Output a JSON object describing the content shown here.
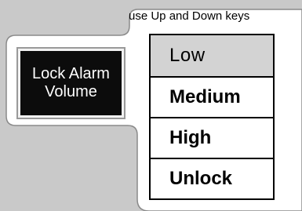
{
  "hint": "use Up and Down keys",
  "lock_button": {
    "line1": "Lock Alarm",
    "line2": "Volume"
  },
  "options": {
    "selected_index": 0,
    "items": [
      {
        "label": "Low"
      },
      {
        "label": "Medium"
      },
      {
        "label": "High"
      },
      {
        "label": "Unlock"
      }
    ]
  },
  "colors": {
    "background": "#c9c9c9",
    "panel": "#ffffff",
    "button_fill": "#0c0c0c",
    "selected_fill": "#d3d3d3"
  }
}
